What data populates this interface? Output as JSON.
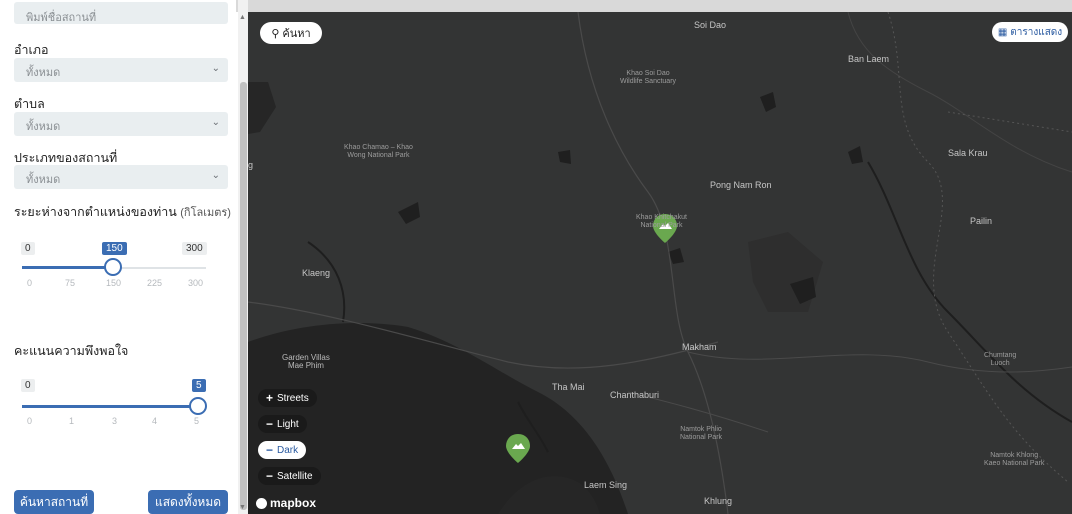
{
  "sidebar": {
    "search_placeholder": "พิมพ์ชื่อสถานที่",
    "district": {
      "label": "อำเภอ",
      "value": "ทั้งหมด"
    },
    "subdistrict": {
      "label": "ตำบล",
      "value": "ทั้งหมด"
    },
    "place_type": {
      "label": "ประเภทของสถานที่",
      "value": "ทั้งหมด"
    },
    "distance": {
      "label": "ระยะห่างจากตำแหน่งของท่าน",
      "unit": "(กิโลเมตร)",
      "min": "0",
      "max": "300",
      "value": "150",
      "level": 0.5,
      "ticks": [
        "0",
        "75",
        "150",
        "225",
        "300"
      ]
    },
    "satisfaction": {
      "label": "คะแนนความพึงพอใจ",
      "min": "0",
      "max": "5",
      "value": "5",
      "level": 1.0,
      "ticks": [
        "0",
        "1",
        "3",
        "4",
        "5"
      ]
    },
    "search_button": "ค้นหาสถานที่",
    "show_all_button": "แสดงทั้งหมด"
  },
  "map": {
    "search_button": "ค้นหา",
    "table_button": "ตารางแสดง",
    "labels": {
      "soi_dao": "Soi Dao",
      "ban_laem": "Ban Laem",
      "khao_soi_dao_1": "Khao Soi Dao",
      "khao_soi_dao_2": "Wildlife Sanctuary",
      "khao_chamao_1": "Khao Chamao – Khao",
      "khao_chamao_2": "Wong National Park",
      "sala_krau": "Sala Krau",
      "pong_nam_ron": "Pong Nam Ron",
      "khao_khitchakut_1": "Khao Khitchakut",
      "khao_khitchakut_2": "National Park",
      "pailin": "Pailin",
      "klaeng": "Klaeng",
      "makham": "Makham",
      "garden_villas_1": "Garden Villas",
      "garden_villas_2": "Mae Phim",
      "chumtang_1": "Chumtang",
      "chumtang_2": "Luoch",
      "tha_mai": "Tha Mai",
      "chanthaburi": "Chanthaburi",
      "namtok_phlio_1": "Namtok Phlio",
      "namtok_phlio_2": "National Park",
      "namtok_khlong_1": "Namtok Khlong",
      "namtok_khlong_2": "Kaeo National Park",
      "laem_sing": "Laem Sing",
      "khlung": "Khlung",
      "edge_g": "g"
    },
    "layers": [
      {
        "sign": "+",
        "label": "Streets"
      },
      {
        "sign": "−",
        "label": "Light"
      },
      {
        "sign": "−",
        "label": "Dark"
      },
      {
        "sign": "−",
        "label": "Satellite"
      }
    ],
    "attribution": "mapbox"
  },
  "colors": {
    "accent": "#3b6db3",
    "map_bg": "#333434",
    "marker": "#6aa84f"
  }
}
